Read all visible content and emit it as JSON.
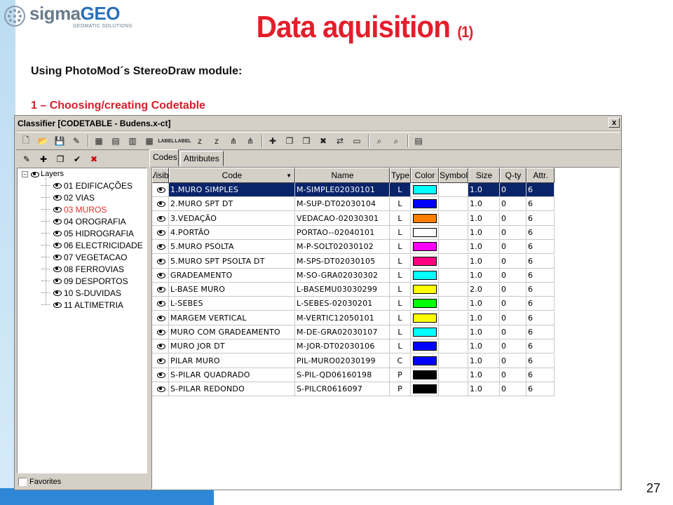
{
  "slide": {
    "logo_brand_a": "sigma",
    "logo_brand_b": "GEO",
    "logo_tagline": "GEOMATIC SOLUTIONS",
    "title": "Data aquisition",
    "title_num": "(1)",
    "subtitle": "Using PhotoMod´s StereoDraw module:",
    "step": "1 – Choosing/creating Codetable",
    "page_number": "27"
  },
  "window": {
    "title": "Classifier [CODETABLE - Budens.x-ct]",
    "close_label": "x"
  },
  "tree": {
    "root": "Layers",
    "layers": [
      {
        "label": "01  EDIFICAÇÕES",
        "highlight": false
      },
      {
        "label": "02  VIAS",
        "highlight": false
      },
      {
        "label": "03  MUROS",
        "highlight": true
      },
      {
        "label": "04  OROGRAFIA",
        "highlight": false
      },
      {
        "label": "05  HIDROGRAFIA",
        "highlight": false
      },
      {
        "label": "06  ELECTRICIDADE",
        "highlight": false
      },
      {
        "label": "07  VEGETACAO",
        "highlight": false
      },
      {
        "label": "08  FERROVIAS",
        "highlight": false
      },
      {
        "label": "09  DESPORTOS",
        "highlight": false
      },
      {
        "label": "10  S-DUVIDAS",
        "highlight": false
      },
      {
        "label": "11  ALTIMETRIA",
        "highlight": false
      }
    ],
    "favorites_label": "Favorites"
  },
  "tabs": [
    {
      "label": "Codes",
      "active": true
    },
    {
      "label": "Attributes",
      "active": false
    }
  ],
  "grid": {
    "columns": [
      "Visibl",
      "Code",
      "Name",
      "Type",
      "Color",
      "Symbol",
      "Size",
      "Q-ty",
      "Attr."
    ],
    "code_sort_icon": "sort-down-icon",
    "rows": [
      {
        "code": "1.MURO SIMPLES",
        "name": "M-SIMPLE02030101",
        "type": "L",
        "color": "#00ffff",
        "size": "1.0",
        "qty": "0",
        "attr": "6",
        "selected": true
      },
      {
        "code": "2.MURO SPT DT",
        "name": "M-SUP-DT02030104",
        "type": "L",
        "color": "#0000ff",
        "size": "1.0",
        "qty": "0",
        "attr": "6",
        "selected": false
      },
      {
        "code": "3.VEDAÇÃO",
        "name": "VEDACAO-02030301",
        "type": "L",
        "color": "#ff8000",
        "size": "1.0",
        "qty": "0",
        "attr": "6",
        "selected": false
      },
      {
        "code": "4.PORTÃO",
        "name": "PORTAO--02040101",
        "type": "L",
        "color": "#ffffff",
        "size": "1.0",
        "qty": "0",
        "attr": "6",
        "selected": false
      },
      {
        "code": "5.MURO PSOLTA",
        "name": "M-P-SOLT02030102",
        "type": "L",
        "color": "#ff00ff",
        "size": "1.0",
        "qty": "0",
        "attr": "6",
        "selected": false
      },
      {
        "code": "5.MURO SPT PSOLTA DT",
        "name": "M-SPS-DT02030105",
        "type": "L",
        "color": "#ff0080",
        "size": "1.0",
        "qty": "0",
        "attr": "6",
        "selected": false
      },
      {
        "code": "GRADEAMENTO",
        "name": "M-SO-GRA02030302",
        "type": "L",
        "color": "#00ffff",
        "size": "1.0",
        "qty": "0",
        "attr": "6",
        "selected": false
      },
      {
        "code": "L-BASE MURO",
        "name": "L-BASEMU03030299",
        "type": "L",
        "color": "#ffff00",
        "size": "2.0",
        "qty": "0",
        "attr": "6",
        "selected": false
      },
      {
        "code": "L-SEBES",
        "name": "L-SEBES-02030201",
        "type": "L",
        "color": "#00ff00",
        "size": "1.0",
        "qty": "0",
        "attr": "6",
        "selected": false
      },
      {
        "code": "MARGEM VERTICAL",
        "name": "M-VERTIC12050101",
        "type": "L",
        "color": "#ffff00",
        "size": "1.0",
        "qty": "0",
        "attr": "6",
        "selected": false
      },
      {
        "code": "MURO COM GRADEAMENTO",
        "name": "M-DE-GRA02030107",
        "type": "L",
        "color": "#00ffff",
        "size": "1.0",
        "qty": "0",
        "attr": "6",
        "selected": false
      },
      {
        "code": "MURO JOR DT",
        "name": "M-JOR-DT02030106",
        "type": "L",
        "color": "#0000ff",
        "size": "1.0",
        "qty": "0",
        "attr": "6",
        "selected": false
      },
      {
        "code": "PILAR MURO",
        "name": "PIL-MURO02030199",
        "type": "C",
        "color": "#0000ff",
        "size": "1.0",
        "qty": "0",
        "attr": "6",
        "selected": false
      },
      {
        "code": "S-PILAR QUADRADO",
        "name": "S-PIL-QD06160198",
        "type": "P",
        "color": "#000000",
        "size": "1.0",
        "qty": "0",
        "attr": "6",
        "selected": false
      },
      {
        "code": "S-PILAR REDONDO",
        "name": "S-PILCR0616097",
        "type": "P",
        "color": "#000000",
        "size": "1.0",
        "qty": "0",
        "attr": "6",
        "selected": false
      }
    ]
  },
  "toolbar": {
    "icons": [
      "new-file-icon",
      "open-folder-icon",
      "save-icon",
      "edit-icon",
      "table-icon",
      "table-edit-icon",
      "grid-icon",
      "grid-wide-icon",
      "label-icon",
      "label-alt-icon",
      "sort-az-icon",
      "sort-za-icon",
      "tree-icon",
      "tree-alt-icon",
      "layers-add-icon",
      "layers-copy-icon",
      "layers-paste-icon",
      "layers-delete-icon",
      "layers-move-icon",
      "view-icon",
      "find-icon",
      "find-next-icon",
      "properties-icon"
    ],
    "label_text": "LABEL"
  }
}
